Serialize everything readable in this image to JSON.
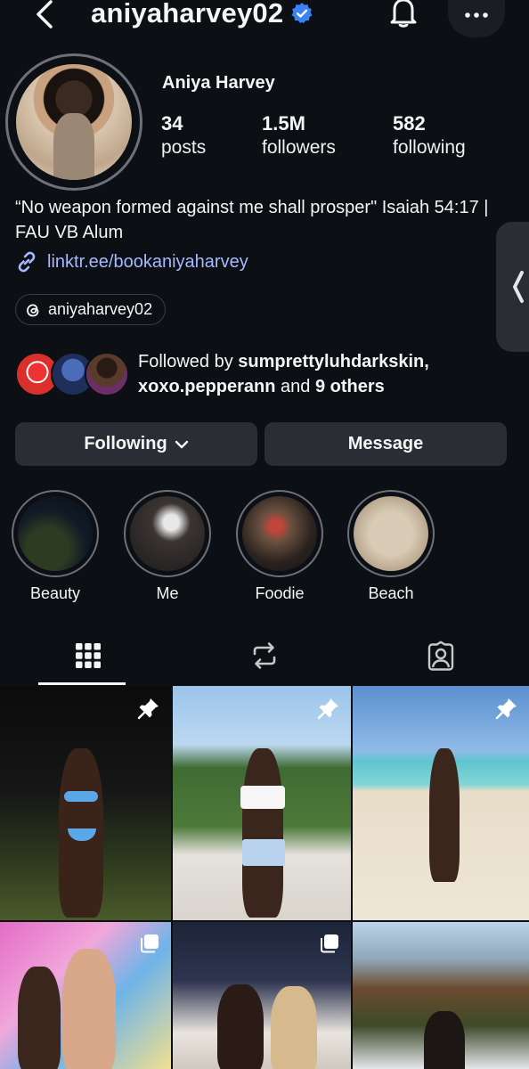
{
  "header": {
    "username": "aniyaharvey02",
    "verified": true,
    "icons": [
      "back-icon",
      "verified-icon",
      "bell-icon",
      "more-icon"
    ]
  },
  "profile": {
    "display_name": "Aniya Harvey",
    "stats": [
      {
        "value": "34",
        "label": "posts"
      },
      {
        "value": "1.5M",
        "label": "followers"
      },
      {
        "value": "582",
        "label": "following"
      }
    ],
    "bio": "“No weapon formed against me shall prosper\" Isaiah 54:17 | FAU VB Alum",
    "link": "linktr.ee/bookaniyaharvey",
    "threads_handle": "aniyaharvey02"
  },
  "followed_by": {
    "prefix": "Followed by",
    "user1": "sumprettyluhdarkskin,",
    "user2": "xoxo.pepperann",
    "middle": "and",
    "others": "9 others"
  },
  "actions": {
    "following_label": "Following",
    "message_label": "Message"
  },
  "highlights": [
    {
      "label": "Beauty"
    },
    {
      "label": "Me"
    },
    {
      "label": "Foodie"
    },
    {
      "label": "Beach"
    }
  ],
  "tabs": [
    "grid-icon",
    "reels-remix-icon",
    "tagged-icon"
  ],
  "colors": {
    "background": "#0c0f14",
    "button": "#2a2d33",
    "link": "#a7b8ff",
    "verified": "#3b82f6"
  }
}
